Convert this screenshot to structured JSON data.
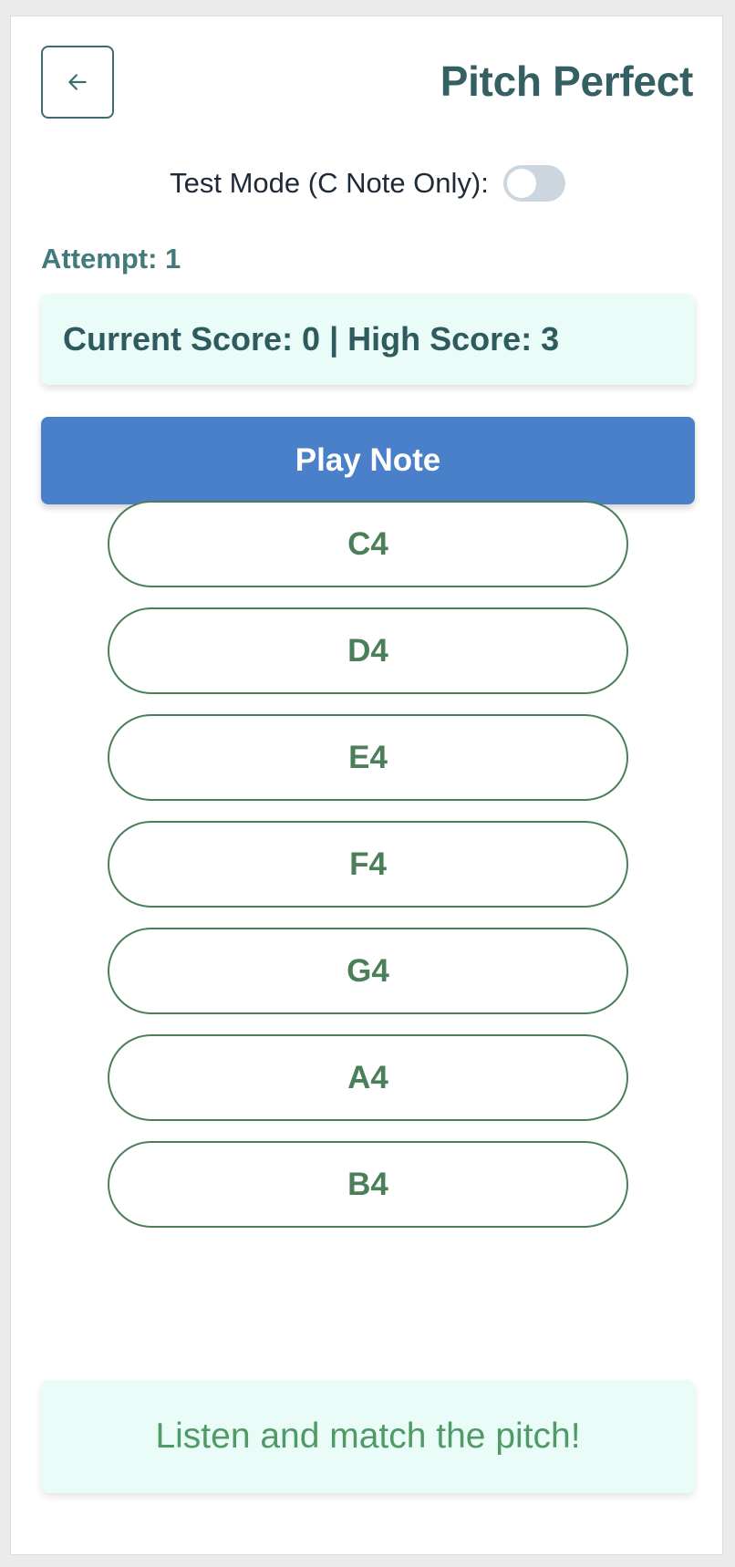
{
  "header": {
    "back_icon": "arrow-left-icon",
    "title": "Pitch Perfect"
  },
  "test_mode": {
    "label": "Test Mode (C Note Only):",
    "enabled": false
  },
  "attempt_text": "Attempt: 1",
  "score_text": "Current Score: 0 | High Score: 3",
  "play_button_label": "Play Note",
  "notes": [
    "C4",
    "D4",
    "E4",
    "F4",
    "G4",
    "A4",
    "B4"
  ],
  "feedback_text": "Listen and match the pitch!",
  "colors": {
    "primary_teal": "#345f63",
    "play_blue": "#4a80c9",
    "note_green": "#4a7f59",
    "panel_mint": "#e9fcf7"
  }
}
